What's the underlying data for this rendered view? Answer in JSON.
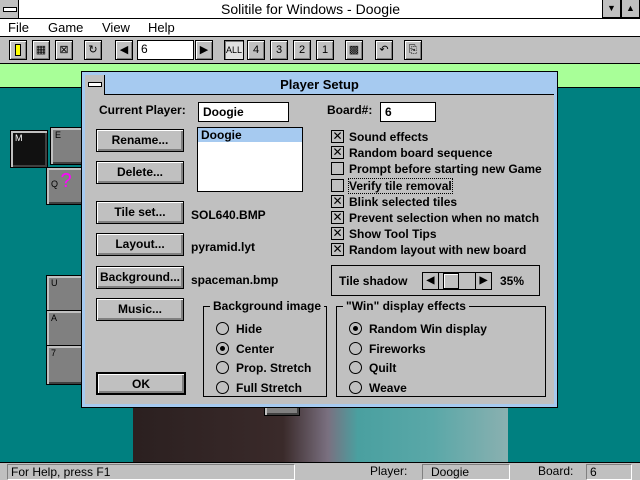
{
  "window": {
    "title": "Solitile for Windows - Doogie"
  },
  "menu": [
    "File",
    "Game",
    "View",
    "Help"
  ],
  "toolbar": {
    "board_number": "6",
    "filters": [
      "ALL",
      "4",
      "3",
      "2",
      "1"
    ]
  },
  "tiles": [
    "M",
    "E",
    "Q",
    "U",
    "A",
    "7"
  ],
  "dialog": {
    "title": "Player Setup",
    "current_player_label": "Current Player:",
    "current_player_value": "Doogie",
    "board_label": "Board#:",
    "board_value": "6",
    "players": [
      "Doogie"
    ],
    "buttons": {
      "rename": "Rename...",
      "delete": "Delete...",
      "tile_set": "Tile set...",
      "layout": "Layout...",
      "background": "Background...",
      "music": "Music...",
      "ok": "OK"
    },
    "files": {
      "tile_set": "SOL640.BMP",
      "layout": "pyramid.lyt",
      "background": "spaceman.bmp"
    },
    "options": [
      {
        "label": "Sound effects",
        "checked": true
      },
      {
        "label": "Random board sequence",
        "checked": true
      },
      {
        "label": "Prompt before starting new Game",
        "checked": false
      },
      {
        "label": "Verify tile removal",
        "checked": false
      },
      {
        "label": "Blink selected tiles",
        "checked": true
      },
      {
        "label": "Prevent selection when no match",
        "checked": true
      },
      {
        "label": "Show Tool Tips",
        "checked": true
      },
      {
        "label": "Random layout with new board",
        "checked": true
      }
    ],
    "tile_shadow": {
      "label": "Tile shadow",
      "value": "35%",
      "percent": 35
    },
    "background_image": {
      "title": "Background image",
      "options": [
        "Hide",
        "Center",
        "Prop. Stretch",
        "Full Stretch"
      ],
      "selected": 1
    },
    "win_effects": {
      "title": "\"Win\" display effects",
      "options": [
        "Random Win display",
        "Fireworks",
        "Quilt",
        "Weave"
      ],
      "selected": 0
    }
  },
  "status": {
    "help": "For Help, press F1",
    "player_label": "Player:",
    "player": "Doogie",
    "board_label": "Board:",
    "board": "6"
  }
}
